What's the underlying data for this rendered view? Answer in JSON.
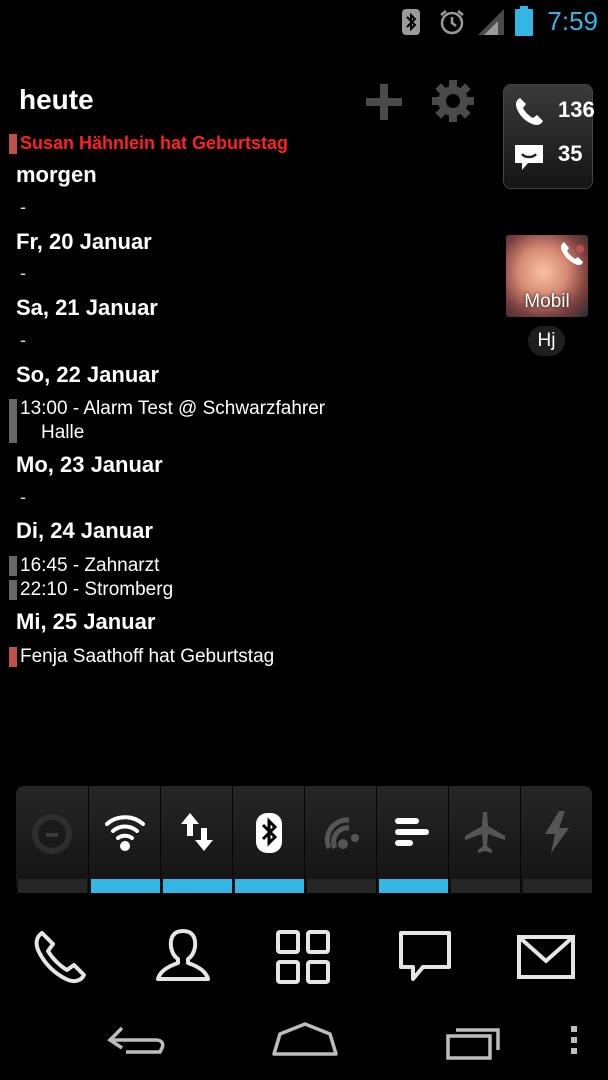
{
  "status_bar": {
    "time": "7:59",
    "icons": [
      "bluetooth-icon",
      "alarm-icon",
      "signal-icon",
      "battery-icon"
    ],
    "accent_color": "#33b5e5"
  },
  "calendar": {
    "today_label": "heute",
    "today_event": "Susan Hähnlein hat Geburtstag",
    "tomorrow_label": "morgen",
    "empty_marker": "-",
    "days": {
      "fri": "Fr, 20 Januar",
      "sat": "Sa, 21 Januar",
      "sun": "So, 22 Januar",
      "mon": "Mo, 23 Januar",
      "tue": "Di, 24 Januar",
      "wed": "Mi, 25 Januar"
    },
    "events": {
      "sun_1_line1": "13:00 - Alarm Test @ Schwarzfahrer",
      "sun_1_line2": "Halle",
      "tue_1": "16:45 - Zahnarzt",
      "tue_2": "22:10 - Stromberg",
      "wed_1": "Fenja Saathoff hat Geburtstag"
    },
    "birthday_color": "#ff2020",
    "event_bar_colors": {
      "birthday": "#c0504d",
      "default": "#666666"
    }
  },
  "counter_widget": {
    "calls": "136",
    "messages": "35"
  },
  "contact_widget": {
    "type_label": "Mobil",
    "name": "Hj"
  },
  "quick_settings": {
    "toggles": [
      {
        "name": "gps",
        "icon": "gps-icon",
        "on": false
      },
      {
        "name": "wifi",
        "icon": "wifi-icon",
        "on": true
      },
      {
        "name": "mobile-data",
        "icon": "data-arrows-icon",
        "on": true
      },
      {
        "name": "bluetooth",
        "icon": "bluetooth-icon",
        "on": true
      },
      {
        "name": "sync",
        "icon": "sync-icon",
        "on": false
      },
      {
        "name": "brightness",
        "icon": "brightness-bars-icon",
        "on": true
      },
      {
        "name": "airplane",
        "icon": "airplane-icon",
        "on": false
      },
      {
        "name": "flash",
        "icon": "flash-icon",
        "on": false
      }
    ]
  },
  "dock": {
    "apps": [
      "phone-icon",
      "contacts-icon",
      "apps-grid-icon",
      "messaging-icon",
      "email-icon"
    ]
  },
  "navigation": {
    "buttons": [
      "back-icon",
      "home-icon",
      "recents-icon",
      "menu-icon"
    ]
  }
}
